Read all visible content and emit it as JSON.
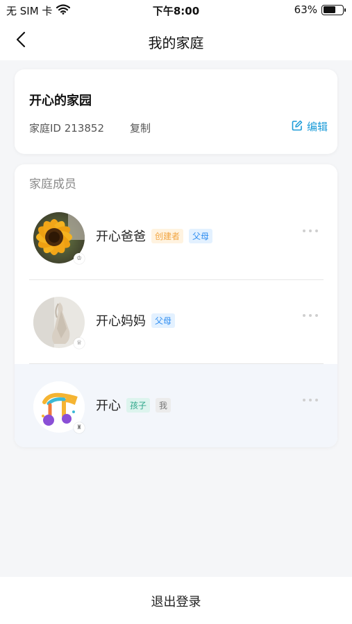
{
  "status_bar": {
    "carrier": "无 SIM 卡",
    "time": "下午8:00",
    "battery_percent_label": "63%",
    "battery_level": 0.63,
    "wifi_icon": "wifi-icon"
  },
  "nav": {
    "title": "我的家庭",
    "back_icon": "chevron-left-icon"
  },
  "family": {
    "name": "开心的家园",
    "id_text": "家庭ID 213852",
    "copy_label": "复制",
    "edit_label": "编辑",
    "edit_icon": "edit-icon"
  },
  "members": {
    "title": "家庭成员",
    "list": [
      {
        "name": "开心爸爸",
        "tags": [
          "创建者",
          "父母"
        ],
        "avatar": "sunflower-photo",
        "badge_icon": "crown-icon"
      },
      {
        "name": "开心妈妈",
        "tags": [
          "父母"
        ],
        "avatar": "dress-photo",
        "badge_icon": "crown-icon"
      },
      {
        "name": "开心",
        "tags": [
          "孩子",
          "我"
        ],
        "avatar": "music-note-illustration",
        "badge_icon": "pawn-icon"
      }
    ],
    "more_icon": "more-dots-icon"
  },
  "footer": {
    "logout_label": "退出登录"
  },
  "colors": {
    "accent": "#1a9bd8",
    "creator_tag": "#f2a541",
    "parent_tag": "#2d8cf0",
    "child_tag": "#2ea68a",
    "background": "#f5f6f8"
  }
}
